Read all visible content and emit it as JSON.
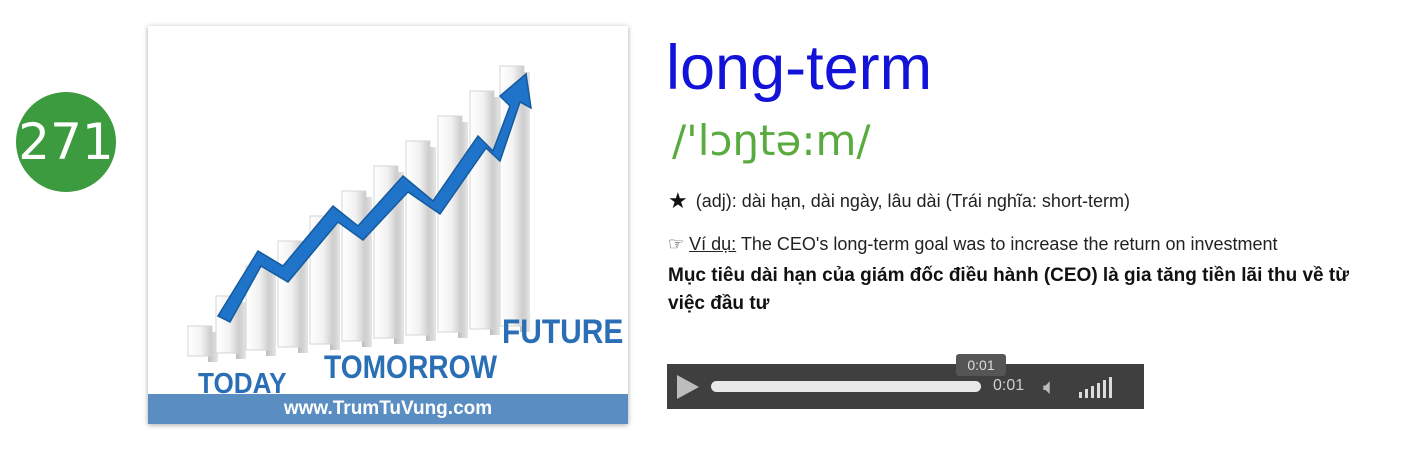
{
  "entry": {
    "number": "271",
    "word": "long-term",
    "pronunciation": "/'lɔŋtə:m/",
    "definition": "(adj): dài hạn, dài ngày, lâu dài (Trái nghĩa: short-term)",
    "example_label": "Ví dụ:",
    "example_en": " The CEO's long-term goal was to increase the return on investment",
    "example_vi": "Mục tiêu dài hạn của giám đốc điều hành (CEO) là gia tăng tiền lãi thu về từ việc đầu tư"
  },
  "image": {
    "word_today": "TODAY",
    "word_tomorrow": "TOMORROW",
    "word_future": "FUTURE",
    "footer": "www.TrumTuVung.com"
  },
  "player": {
    "current_time": "0:01",
    "tooltip_time": "0:01",
    "progress": 1.0
  },
  "icons": {
    "definition": "star-icon",
    "example": "pointing-hand-icon",
    "play": "play-icon",
    "volume": "volume-icon"
  },
  "colors": {
    "badge": "#3c9b3e",
    "word": "#1212d8",
    "pronunciation": "#5aab3f",
    "arrow": "#1f73c9",
    "player_bg": "#3f3f3f"
  }
}
